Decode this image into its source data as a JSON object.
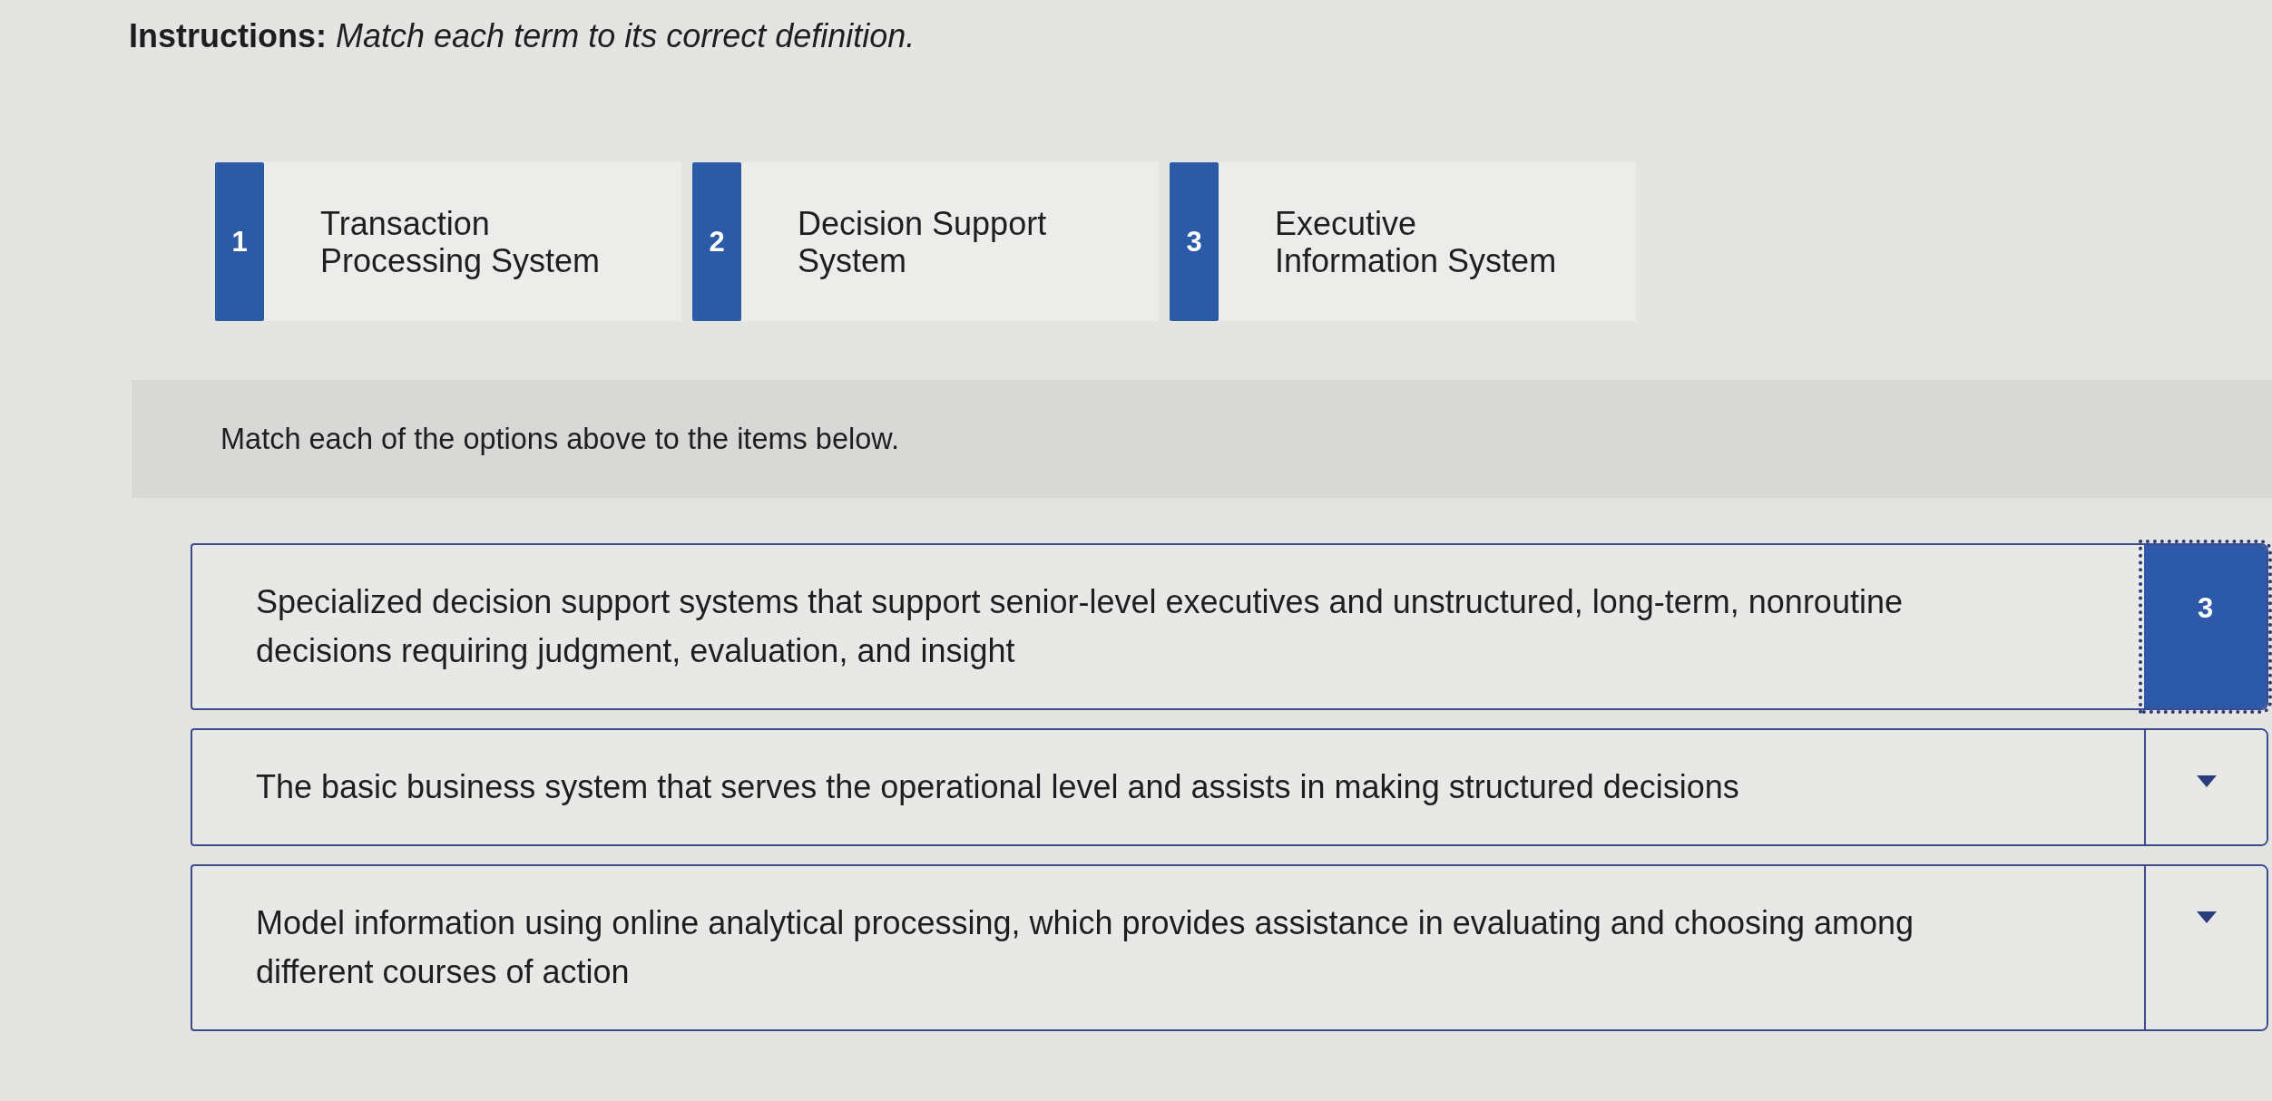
{
  "instructions": "**Instructions:** *Match each term to its correct definition.*",
  "terms": [
    {
      "number": "1",
      "label": "Transaction Processing System"
    },
    {
      "number": "2",
      "label": "Decision Support System"
    },
    {
      "number": "3",
      "label": "Executive Information System"
    }
  ],
  "prompt": "Match each of the options above to the items below.",
  "items": [
    {
      "definition": "Specialized decision support systems that support senior-level executives and unstructured, long-term, nonroutine decisions requiring judgment, evaluation, and insight",
      "answer": "3",
      "focused": true
    },
    {
      "definition": "The basic business system that serves the operational level and assists in making structured decisions",
      "focused": false
    },
    {
      "definition": "Model information using online analytical processing, which provides assistance in evaluating and choosing among different courses of action",
      "focused": false
    }
  ]
}
